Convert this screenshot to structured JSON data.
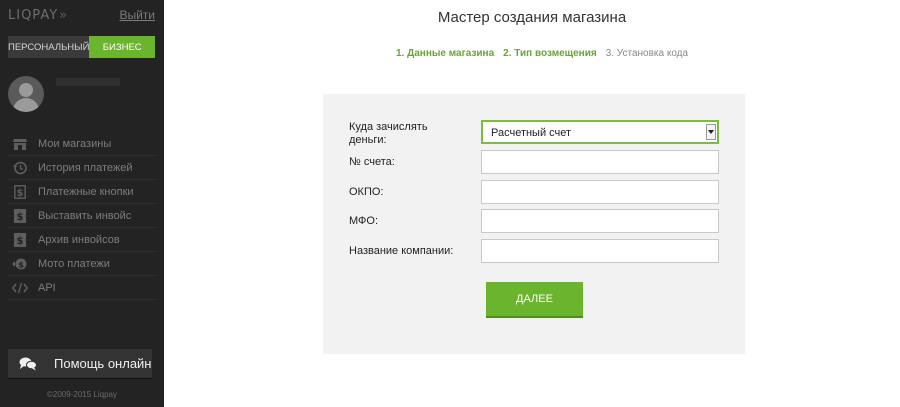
{
  "sidebar": {
    "logo_text": "LIQPAY",
    "logo_arrows": "»",
    "logout_label": "Выйти",
    "mode_personal": "ПЕРСОНАЛЬНЫЙ",
    "mode_business": "БИЗНЕС",
    "menu": [
      {
        "label": "Мои магазины",
        "icon": "store-icon"
      },
      {
        "label": "История платежей",
        "icon": "history-icon"
      },
      {
        "label": "Платежные кнопки",
        "icon": "dollar-doc-icon"
      },
      {
        "label": "Выставить инвойс",
        "icon": "invoice-icon"
      },
      {
        "label": "Архив инвойсов",
        "icon": "invoice-archive-icon"
      },
      {
        "label": "Мото платежи",
        "icon": "moto-payment-icon"
      },
      {
        "label": "API",
        "icon": "code-icon"
      }
    ],
    "help_label": "Помощь онлайн",
    "copyright": "©2009-2015 Liqpay"
  },
  "main": {
    "title": "Мастер создания магазина",
    "steps": [
      {
        "label": "1. Данные магазина",
        "state": "active"
      },
      {
        "label": "2. Тип возмещения",
        "state": "active"
      },
      {
        "label": "3. Установка кода",
        "state": "inactive"
      }
    ],
    "form": {
      "destination_label_line1": "Куда зачислять",
      "destination_label_line2": "деньги:",
      "destination_value": "Расчетный счет",
      "account_label": "№ счета:",
      "account_value": "",
      "okpo_label": "ОКПО:",
      "okpo_value": "",
      "mfo_label": "МФО:",
      "mfo_value": "",
      "company_label": "Название компании:",
      "company_value": "",
      "submit_label": "ДАЛЕЕ"
    }
  },
  "colors": {
    "accent": "#6bb42d",
    "sidebar_bg": "#232323",
    "panel_bg": "#f2f2f2"
  }
}
